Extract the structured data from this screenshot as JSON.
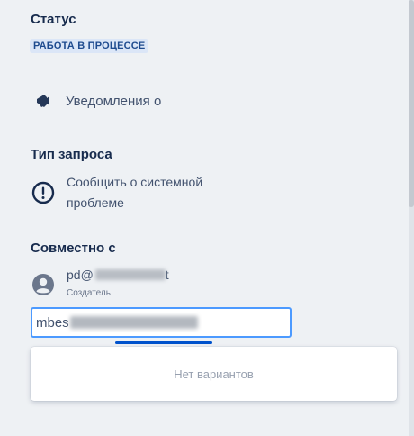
{
  "status": {
    "title": "Статус",
    "badge": "РАБОТА В ПРОЦЕССЕ"
  },
  "notifications": {
    "label": "Уведомления о",
    "icon": "megaphone-icon"
  },
  "request_type": {
    "title": "Тип запроса",
    "line1": "Сообщить о системной",
    "line2": "проблеме",
    "icon": "exclamation-circle-icon"
  },
  "shared": {
    "title": "Совместно с",
    "person": {
      "email_prefix": "pd@",
      "email_suffix": "t",
      "role": "Создатель",
      "icon": "user-avatar-icon"
    },
    "search": {
      "value_prefix": "mbes"
    },
    "dropdown": {
      "empty_text": "Нет вариантов"
    }
  },
  "colors": {
    "accent": "#4c9aff",
    "badge_bg": "#dbe6f7",
    "badge_text": "#1e4b8f",
    "loading": "#0052cc"
  }
}
